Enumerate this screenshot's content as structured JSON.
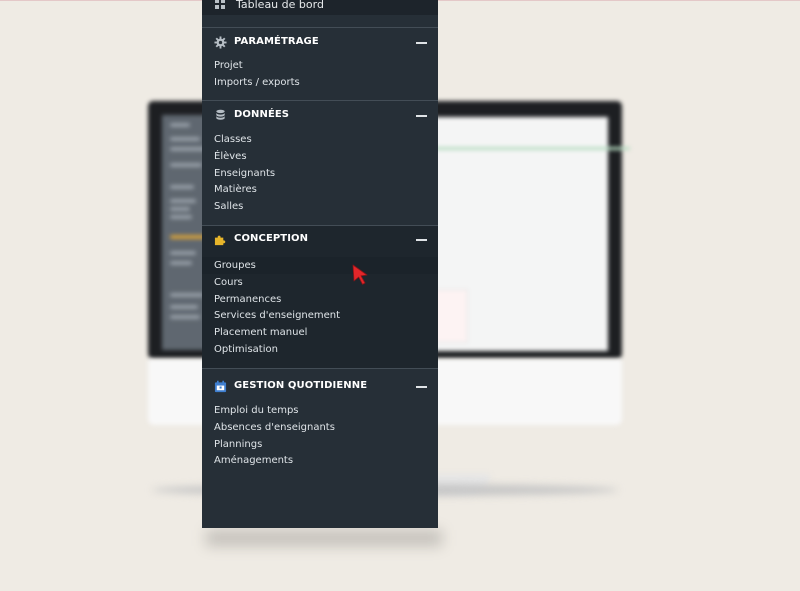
{
  "menu": {
    "top_item": {
      "label": "Tableau de bord",
      "icon": "grid-icon"
    },
    "sections": [
      {
        "title": "PARAMÉTRAGE",
        "icon": "gear-icon",
        "items": [
          "Projet",
          "Imports / exports"
        ]
      },
      {
        "title": "DONNÉES",
        "icon": "database-icon",
        "items": [
          "Classes",
          "Élèves",
          "Enseignants",
          "Matières",
          "Salles"
        ]
      },
      {
        "title": "CONCEPTION",
        "icon": "puzzle-icon",
        "active_item": "Groupes",
        "items": [
          "Groupes",
          "Cours",
          "Permanences",
          "Services d'enseignement",
          "Placement manuel",
          "Optimisation"
        ]
      },
      {
        "title": "GESTION QUOTIDIENNE",
        "icon": "calendar-icon",
        "items": [
          "Emploi du temps",
          "Absences d'enseignants",
          "Plannings",
          "Aménagements"
        ]
      }
    ]
  },
  "colors": {
    "background": "#efebe4",
    "menu_bg": "#262f37",
    "menu_active_bg": "#1e262d",
    "accent_yellow": "#e7b52a",
    "accent_blue": "#3f7fd0",
    "cursor_red": "#e3262a"
  }
}
